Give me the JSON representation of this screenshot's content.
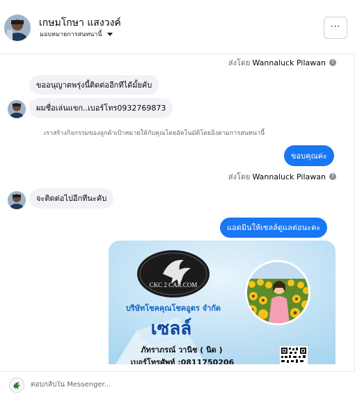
{
  "header": {
    "customer_name": "เกษมโกษา แสงวงค์",
    "assign_label": "มอบหมายการสนทนานี้",
    "more_label": "···"
  },
  "messages": {
    "sent_by_1": {
      "prefix": "ส่งโดย",
      "name": "Wannaluck Pilawan",
      "help": "?"
    },
    "in_1": "ขออนุญาตพรุ่งนี้ติดต่ออีกทีได้มั้ยคับ",
    "in_2": "ผมชื่อเล่นแขก..เบอร์โทร0932769873",
    "system_note": "เราสร้างกิจกรรมของลูกค้าเป้าหมายให้กับคุณโดยอัตโนมัติโดยอิงตามการสนทนานี้",
    "out_1": "ขอบคุณค่ะ",
    "sent_by_2": {
      "prefix": "ส่งโดย",
      "name": "Wannaluck Pilawan",
      "help": "?"
    },
    "in_3": "จะติดต่อไปอีกทีนะคับ",
    "out_2": "แอดมินให้เซลล์ดูแลต่อนะคะ"
  },
  "card": {
    "logo_text": "CKC 2 CAR.COM",
    "company": "บริษัทโชคคุณโชคอูตร จำกัด",
    "role": "เซลล์",
    "person": "ภัทราภรณ์ วานิช ( นิด )",
    "phone": "เบอร์โทรศัพท์ :0811750206"
  },
  "composer": {
    "placeholder": "ตอบกลับใน Messenger..."
  },
  "colors": {
    "accent": "#1877f2",
    "incoming_bubble": "#f0f2f5",
    "muted_text": "#65676b"
  }
}
